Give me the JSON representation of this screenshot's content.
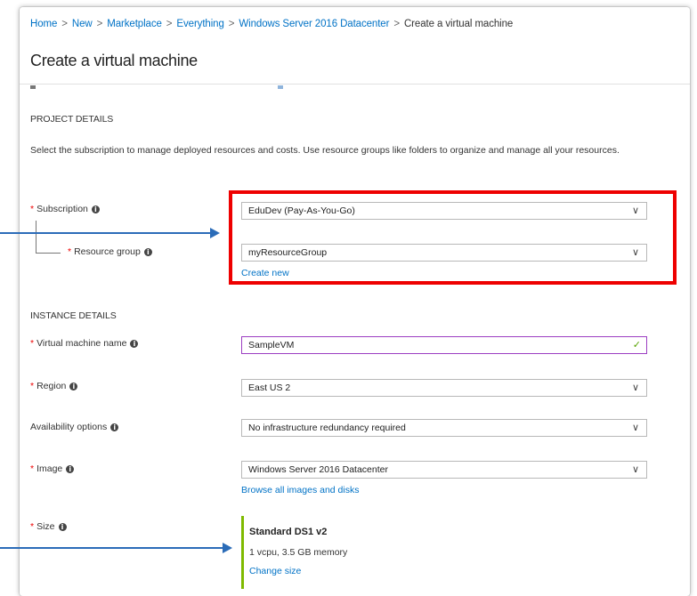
{
  "breadcrumb": {
    "items": [
      "Home",
      "New",
      "Marketplace",
      "Everything",
      "Windows Server 2016 Datacenter"
    ],
    "current": "Create a virtual machine",
    "separator": ">"
  },
  "page_title": "Create a virtual machine",
  "project": {
    "heading": "PROJECT DETAILS",
    "description": "Select the subscription to manage deployed resources and costs. Use resource groups like folders to organize and manage all your resources.",
    "subscription_label": "Subscription",
    "subscription_value": "EduDev (Pay-As-You-Go)",
    "resource_group_label": "Resource group",
    "resource_group_value": "myResourceGroup",
    "create_new": "Create new"
  },
  "instance": {
    "heading": "INSTANCE DETAILS",
    "vm_name_label": "Virtual machine name",
    "vm_name_value": "SampleVM",
    "region_label": "Region",
    "region_value": "East US 2",
    "availability_label": "Availability options",
    "availability_value": "No infrastructure redundancy required",
    "image_label": "Image",
    "image_value": "Windows Server 2016 Datacenter",
    "browse_images": "Browse all images and disks",
    "size_label": "Size",
    "size_name": "Standard DS1 v2",
    "size_spec": "1 vcpu, 3.5 GB memory",
    "change_size": "Change size"
  },
  "glyphs": {
    "required": "*",
    "info": "i",
    "chevron": "∨",
    "check": "✓"
  },
  "colors": {
    "link": "#0072c6",
    "required": "#e00000",
    "highlight_box": "#ee0000",
    "arrow": "#2b6cb8",
    "size_accent": "#7fba00",
    "valid_check": "#57a300"
  }
}
